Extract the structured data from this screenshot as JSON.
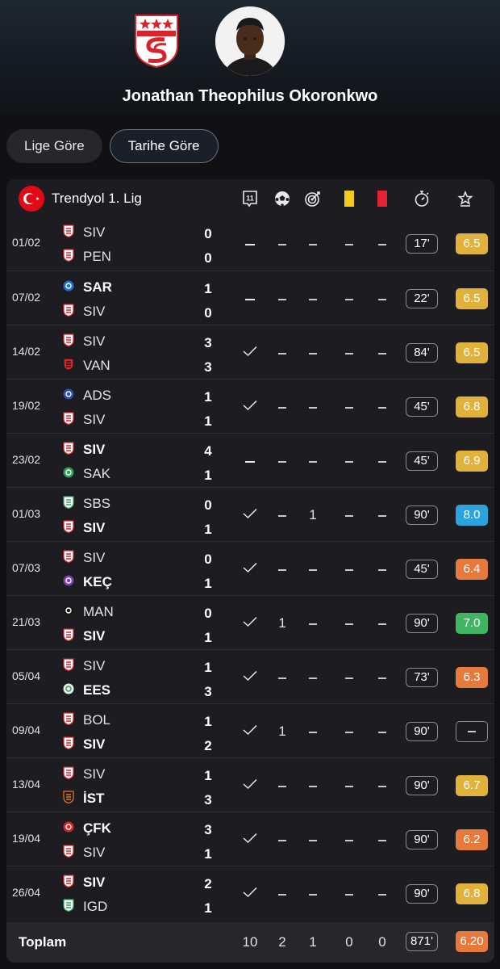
{
  "player": {
    "name": "Jonathan Theophilus Okoronkwo",
    "club_logo_text": "SİVASSPOR 1967"
  },
  "tabs": [
    {
      "label": "Lige Göre",
      "active": false
    },
    {
      "label": "Tarihe Göre",
      "active": true
    }
  ],
  "league": {
    "name": "Trendyol 1. Lig",
    "flag": "turkey-flag"
  },
  "columns": [
    "lineup-icon",
    "goals-ball-icon",
    "assists-target-icon",
    "yellow-card-icon",
    "red-card-icon",
    "minutes-stopwatch-icon",
    "rating-star-icon"
  ],
  "colors": {
    "rating_yellow": "#e0b23c",
    "rating_orange": "#e67a3c",
    "rating_green": "#3fb463",
    "rating_blue": "#2aa3de"
  },
  "matches": [
    {
      "date": "01/02",
      "home": "SIV",
      "away": "PEN",
      "home_score": "0",
      "away_score": "0",
      "winner": "",
      "lineup": "–",
      "goals": "–",
      "assists": "–",
      "yellow": "–",
      "red": "–",
      "minutes": "17'",
      "rating": "6.5",
      "rating_color": "yellow"
    },
    {
      "date": "07/02",
      "home": "SAR",
      "away": "SIV",
      "home_score": "1",
      "away_score": "0",
      "winner": "home",
      "lineup": "–",
      "goals": "–",
      "assists": "–",
      "yellow": "–",
      "red": "–",
      "minutes": "22'",
      "rating": "6.5",
      "rating_color": "yellow"
    },
    {
      "date": "14/02",
      "home": "SIV",
      "away": "VAN",
      "home_score": "3",
      "away_score": "3",
      "winner": "",
      "lineup": "✓",
      "goals": "–",
      "assists": "–",
      "yellow": "–",
      "red": "–",
      "minutes": "84'",
      "rating": "6.5",
      "rating_color": "yellow"
    },
    {
      "date": "19/02",
      "home": "ADS",
      "away": "SIV",
      "home_score": "1",
      "away_score": "1",
      "winner": "",
      "lineup": "✓",
      "goals": "–",
      "assists": "–",
      "yellow": "–",
      "red": "–",
      "minutes": "45'",
      "rating": "6.8",
      "rating_color": "yellow"
    },
    {
      "date": "23/02",
      "home": "SIV",
      "away": "SAK",
      "home_score": "4",
      "away_score": "1",
      "winner": "home",
      "lineup": "–",
      "goals": "–",
      "assists": "–",
      "yellow": "–",
      "red": "–",
      "minutes": "45'",
      "rating": "6.9",
      "rating_color": "yellow"
    },
    {
      "date": "01/03",
      "home": "SBS",
      "away": "SIV",
      "home_score": "0",
      "away_score": "1",
      "winner": "away",
      "lineup": "✓",
      "goals": "–",
      "assists": "1",
      "yellow": "–",
      "red": "–",
      "minutes": "90'",
      "rating": "8.0",
      "rating_color": "blue"
    },
    {
      "date": "07/03",
      "home": "SIV",
      "away": "KEÇ",
      "home_score": "0",
      "away_score": "1",
      "winner": "away",
      "lineup": "✓",
      "goals": "–",
      "assists": "–",
      "yellow": "–",
      "red": "–",
      "minutes": "45'",
      "rating": "6.4",
      "rating_color": "orange"
    },
    {
      "date": "21/03",
      "home": "MAN",
      "away": "SIV",
      "home_score": "0",
      "away_score": "1",
      "winner": "away",
      "lineup": "✓",
      "goals": "1",
      "assists": "–",
      "yellow": "–",
      "red": "–",
      "minutes": "90'",
      "rating": "7.0",
      "rating_color": "green"
    },
    {
      "date": "05/04",
      "home": "SIV",
      "away": "EES",
      "home_score": "1",
      "away_score": "3",
      "winner": "away",
      "lineup": "✓",
      "goals": "–",
      "assists": "–",
      "yellow": "–",
      "red": "–",
      "minutes": "73'",
      "rating": "6.3",
      "rating_color": "orange"
    },
    {
      "date": "09/04",
      "home": "BOL",
      "away": "SIV",
      "home_score": "1",
      "away_score": "2",
      "winner": "away",
      "lineup": "✓",
      "goals": "1",
      "assists": "–",
      "yellow": "–",
      "red": "–",
      "minutes": "90'",
      "rating": "–",
      "rating_color": "none"
    },
    {
      "date": "13/04",
      "home": "SIV",
      "away": "İST",
      "home_score": "1",
      "away_score": "3",
      "winner": "away",
      "lineup": "✓",
      "goals": "–",
      "assists": "–",
      "yellow": "–",
      "red": "–",
      "minutes": "90'",
      "rating": "6.7",
      "rating_color": "yellow"
    },
    {
      "date": "19/04",
      "home": "ÇFK",
      "away": "SIV",
      "home_score": "3",
      "away_score": "1",
      "winner": "home",
      "lineup": "✓",
      "goals": "–",
      "assists": "–",
      "yellow": "–",
      "red": "–",
      "minutes": "90'",
      "rating": "6.2",
      "rating_color": "orange"
    },
    {
      "date": "26/04",
      "home": "SIV",
      "away": "IGD",
      "home_score": "2",
      "away_score": "1",
      "winner": "home",
      "lineup": "✓",
      "goals": "–",
      "assists": "–",
      "yellow": "–",
      "red": "–",
      "minutes": "90'",
      "rating": "6.8",
      "rating_color": "yellow"
    }
  ],
  "total": {
    "label": "Toplam",
    "lineup": "10",
    "goals": "2",
    "assists": "1",
    "yellow": "0",
    "red": "0",
    "minutes": "871'",
    "rating": "6.20",
    "rating_color": "orange"
  }
}
